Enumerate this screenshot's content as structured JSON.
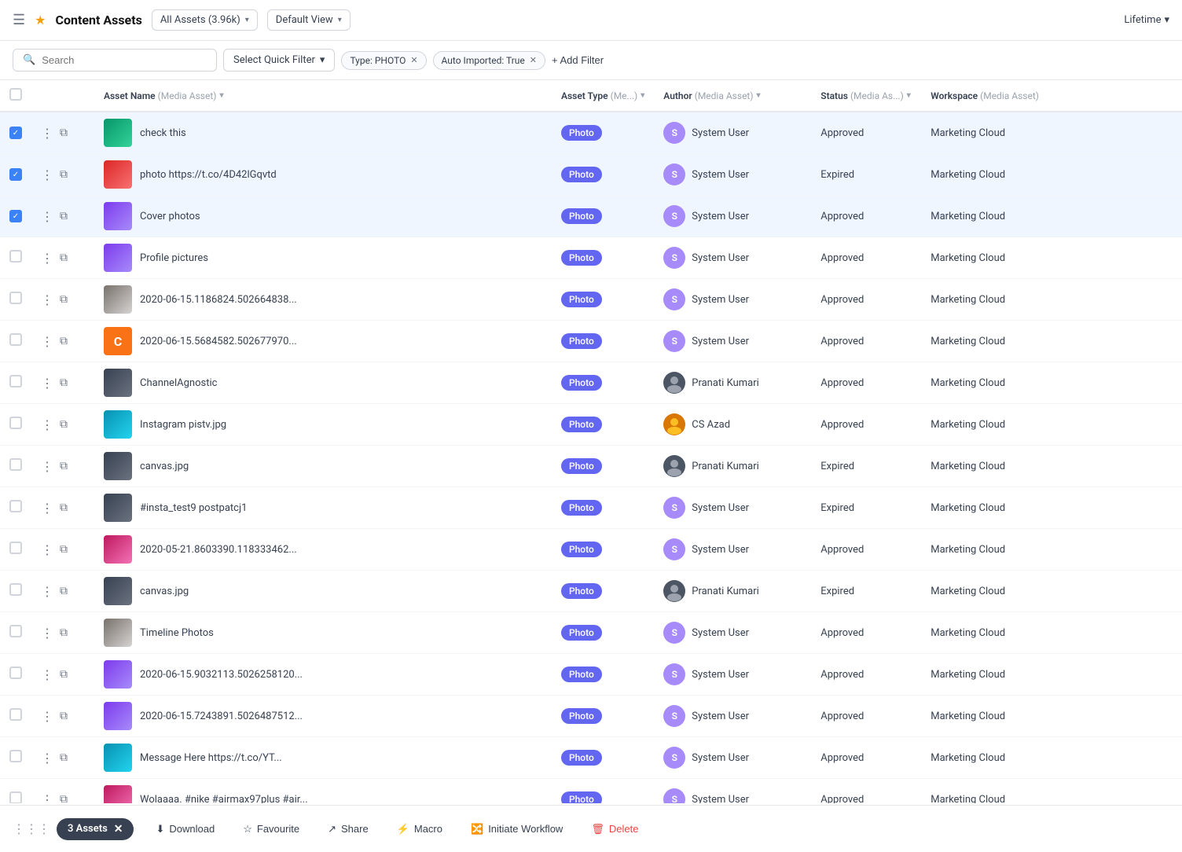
{
  "header": {
    "menu_icon": "☰",
    "star_icon": "★",
    "title": "Content Assets",
    "all_assets_label": "All Assets (3.96k)",
    "default_view_label": "Default View",
    "lifetime_label": "Lifetime"
  },
  "filter_bar": {
    "search_placeholder": "Search",
    "quick_filter_label": "Select Quick Filter",
    "type_filter": "Type: PHOTO",
    "auto_imported_filter": "Auto Imported: True",
    "add_filter_label": "+ Add Filter"
  },
  "table": {
    "columns": [
      {
        "id": "name",
        "label": "Asset Name",
        "sub": "(Media Asset)"
      },
      {
        "id": "type",
        "label": "Asset Type",
        "sub": "(Me...)"
      },
      {
        "id": "author",
        "label": "Author",
        "sub": "(Media Asset)"
      },
      {
        "id": "status",
        "label": "Status",
        "sub": "(Media As...)"
      },
      {
        "id": "workspace",
        "label": "Workspace",
        "sub": "(Media Asset)"
      }
    ],
    "rows": [
      {
        "id": 1,
        "checked": true,
        "name": "check this",
        "type": "Photo",
        "author": "System User",
        "author_type": "s",
        "status": "Approved",
        "workspace": "Marketing Cloud",
        "thumb_class": "thumb-green"
      },
      {
        "id": 2,
        "checked": true,
        "name": "photo https://t.co/4D42lGqvtd",
        "type": "Photo",
        "author": "System User",
        "author_type": "s",
        "status": "Expired",
        "workspace": "Marketing Cloud",
        "thumb_class": "thumb-red"
      },
      {
        "id": 3,
        "checked": true,
        "name": "Cover photos",
        "type": "Photo",
        "author": "System User",
        "author_type": "s",
        "status": "Approved",
        "workspace": "Marketing Cloud",
        "thumb_class": "thumb-vid"
      },
      {
        "id": 4,
        "checked": false,
        "name": "Profile pictures",
        "type": "Photo",
        "author": "System User",
        "author_type": "s",
        "status": "Approved",
        "workspace": "Marketing Cloud",
        "thumb_class": "thumb-vid"
      },
      {
        "id": 5,
        "checked": false,
        "name": "2020-06-15.1186824.502664838...",
        "type": "Photo",
        "author": "System User",
        "author_type": "s",
        "status": "Approved",
        "workspace": "Marketing Cloud",
        "thumb_class": "thumb-stone"
      },
      {
        "id": 6,
        "checked": false,
        "name": "2020-06-15.5684582.502677970...",
        "type": "Photo",
        "author": "System User",
        "author_type": "s",
        "status": "Approved",
        "workspace": "Marketing Cloud",
        "thumb_class": "thumb-c",
        "is_c": true
      },
      {
        "id": 7,
        "checked": false,
        "name": "ChannelAgnostic",
        "type": "Photo",
        "author": "Pranati Kumari",
        "author_type": "pk",
        "status": "Approved",
        "workspace": "Marketing Cloud",
        "thumb_class": "thumb-dark"
      },
      {
        "id": 8,
        "checked": false,
        "name": "Instagram pistv.jpg",
        "type": "Photo",
        "author": "CS Azad",
        "author_type": "cs",
        "status": "Approved",
        "workspace": "Marketing Cloud",
        "thumb_class": "thumb-teal"
      },
      {
        "id": 9,
        "checked": false,
        "name": "canvas.jpg",
        "type": "Photo",
        "author": "Pranati Kumari",
        "author_type": "pk",
        "status": "Expired",
        "workspace": "Marketing Cloud",
        "thumb_class": "thumb-dark"
      },
      {
        "id": 10,
        "checked": false,
        "name": "#insta_test9 postpatcj1",
        "type": "Photo",
        "author": "System User",
        "author_type": "s",
        "status": "Expired",
        "workspace": "Marketing Cloud",
        "thumb_class": "thumb-dark"
      },
      {
        "id": 11,
        "checked": false,
        "name": "2020-05-21.8603390.118333462...",
        "type": "Photo",
        "author": "System User",
        "author_type": "s",
        "status": "Approved",
        "workspace": "Marketing Cloud",
        "thumb_class": "thumb-flower"
      },
      {
        "id": 12,
        "checked": false,
        "name": "canvas.jpg",
        "type": "Photo",
        "author": "Pranati Kumari",
        "author_type": "pk",
        "status": "Expired",
        "workspace": "Marketing Cloud",
        "thumb_class": "thumb-dark"
      },
      {
        "id": 13,
        "checked": false,
        "name": "Timeline Photos",
        "type": "Photo",
        "author": "System User",
        "author_type": "s",
        "status": "Approved",
        "workspace": "Marketing Cloud",
        "thumb_class": "thumb-stone"
      },
      {
        "id": 14,
        "checked": false,
        "name": "2020-06-15.9032113.5026258120...",
        "type": "Photo",
        "author": "System User",
        "author_type": "s",
        "status": "Approved",
        "workspace": "Marketing Cloud",
        "thumb_class": "thumb-vid"
      },
      {
        "id": 15,
        "checked": false,
        "name": "2020-06-15.7243891.5026487512...",
        "type": "Photo",
        "author": "System User",
        "author_type": "s",
        "status": "Approved",
        "workspace": "Marketing Cloud",
        "thumb_class": "thumb-vid"
      },
      {
        "id": 16,
        "checked": false,
        "name": "Message Here https://t.co/YT...",
        "type": "Photo",
        "author": "System User",
        "author_type": "s",
        "status": "Approved",
        "workspace": "Marketing Cloud",
        "thumb_class": "thumb-teal"
      },
      {
        "id": 17,
        "checked": false,
        "name": "Wolaaaa. #nike #airmax97plus #air...",
        "type": "Photo",
        "author": "System User",
        "author_type": "s",
        "status": "Approved",
        "workspace": "Marketing Cloud",
        "thumb_class": "thumb-flower"
      }
    ]
  },
  "bottom_bar": {
    "assets_count": "3 Assets",
    "download_label": "Download",
    "favourite_label": "Favourite",
    "share_label": "Share",
    "macro_label": "Macro",
    "initiate_workflow_label": "Initiate Workflow",
    "delete_label": "Delete",
    "download_icon": "⬇",
    "favourite_icon": "☆",
    "share_icon": "↗",
    "macro_icon": "⚡",
    "workflow_icon": "🔀",
    "delete_icon": "🗑"
  }
}
